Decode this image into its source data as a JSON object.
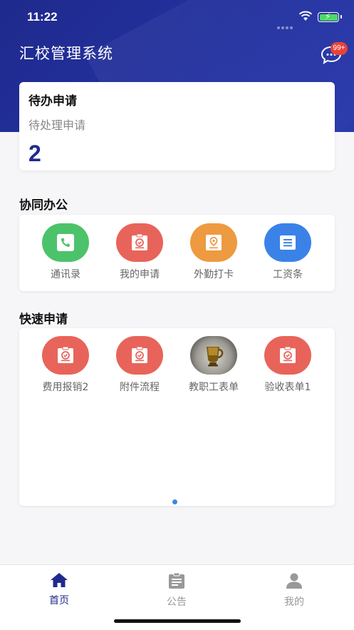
{
  "status": {
    "time": "11:22"
  },
  "header": {
    "title": "汇校管理系统",
    "badge": "99+"
  },
  "pending": {
    "title": "待办申请",
    "subtitle": "待处理申请",
    "count": "2"
  },
  "collab": {
    "title": "协同办公",
    "items": [
      {
        "label": "通讯录",
        "color": "#4cc36b",
        "icon": "phone-icon"
      },
      {
        "label": "我的申请",
        "color": "#e8645a",
        "icon": "clipboard-check-icon"
      },
      {
        "label": "外勤打卡",
        "color": "#ee9a40",
        "icon": "location-card-icon"
      },
      {
        "label": "工资条",
        "color": "#3b82e8",
        "icon": "list-document-icon"
      }
    ]
  },
  "quick": {
    "title": "快速申请",
    "items": [
      {
        "label": "费用报销2",
        "color": "#e8645a",
        "icon": "clipboard-check-icon"
      },
      {
        "label": "附件流程",
        "color": "#e8645a",
        "icon": "clipboard-check-icon"
      },
      {
        "label": "教职工表单",
        "color": "#1b1b1b",
        "icon": "cup-photo"
      },
      {
        "label": "验收表单1",
        "color": "#e8645a",
        "icon": "clipboard-check-icon"
      }
    ]
  },
  "tabs": [
    {
      "label": "首页",
      "icon": "home-icon",
      "active": true,
      "color": "#1f2a8c"
    },
    {
      "label": "公告",
      "icon": "notice-icon",
      "active": false,
      "color": "#999999"
    },
    {
      "label": "我的",
      "icon": "user-icon",
      "active": false,
      "color": "#999999"
    }
  ]
}
